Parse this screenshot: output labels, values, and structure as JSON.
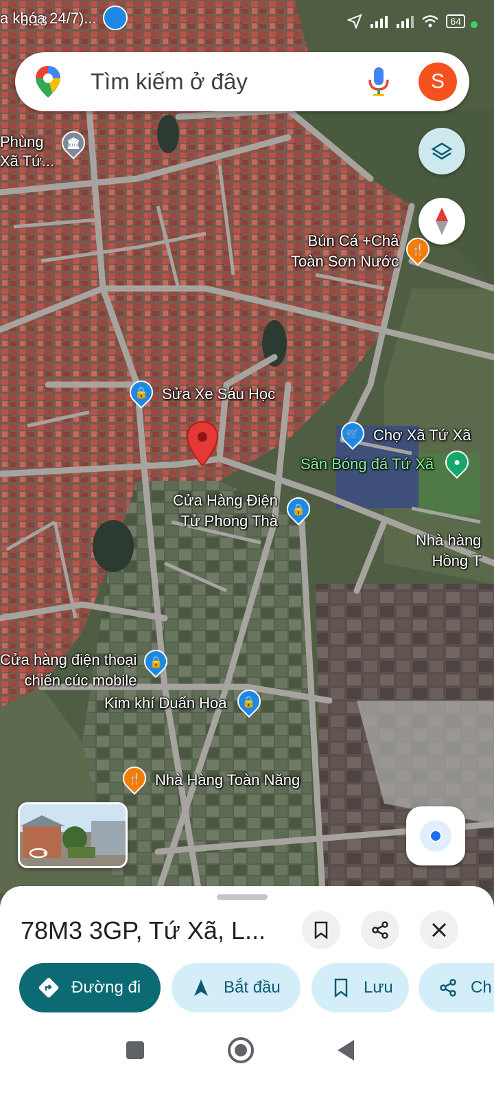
{
  "status_bar": {
    "notification_text": "a khóa 24/7)...",
    "time": "8:18",
    "battery": "64"
  },
  "search": {
    "placeholder": "Tìm kiếm ở đây",
    "avatar_letter": "S"
  },
  "map_pois": [
    {
      "name": "poi-phung",
      "label": "Phùng\nXã Tứ...",
      "icon": "museum-icon",
      "color": "#7b8a99"
    },
    {
      "name": "poi-bun-ca",
      "label": "Bún Cá +Chả\nToàn Sơn Nước",
      "icon": "fork-knife-icon",
      "color": "#f57c00"
    },
    {
      "name": "poi-sua-xe",
      "label": "Sửa Xe Sáu Học",
      "icon": "shopping-bag-icon",
      "color": "#1e88e5"
    },
    {
      "name": "poi-cho",
      "label": "Chợ Xã Tứ Xã",
      "icon": "shopping-cart-icon",
      "color": "#1e88e5"
    },
    {
      "name": "poi-san-bong",
      "label": "Sân Bóng đá Tứ Xã",
      "icon": "park-icon",
      "color": "#14a86a"
    },
    {
      "name": "poi-cua-hang-dien-tu",
      "label": "Cửa Hàng Điện\nTử Phong Thà",
      "icon": "shopping-bag-icon",
      "color": "#1e88e5"
    },
    {
      "name": "poi-nha-hang-hong",
      "label": "Nhà hàng\nHồng T",
      "icon": "fork-knife-icon",
      "color": "#f57c00"
    },
    {
      "name": "poi-dien-thoai",
      "label": "Cửa hàng điện thoại\nchiến cúc mobile",
      "icon": "shopping-bag-icon",
      "color": "#1e88e5"
    },
    {
      "name": "poi-kim-khi",
      "label": "Kim khí Duẩn Hoa",
      "icon": "shopping-bag-icon",
      "color": "#1e88e5"
    },
    {
      "name": "poi-nha-hang-toan-nang",
      "label": "Nhà Hàng Toàn Năng",
      "icon": "fork-knife-icon",
      "color": "#f57c00"
    }
  ],
  "place": {
    "title": "78M3 3GP, Tứ Xã, L..."
  },
  "actions": {
    "directions": "Đường đi",
    "start": "Bắt đầu",
    "save": "Lưu",
    "share": "Ch"
  },
  "colors": {
    "accent": "#0b6a73",
    "chip_bg": "#d4eef9",
    "marker_red": "#e53935",
    "location_blue": "#1a73e8"
  }
}
